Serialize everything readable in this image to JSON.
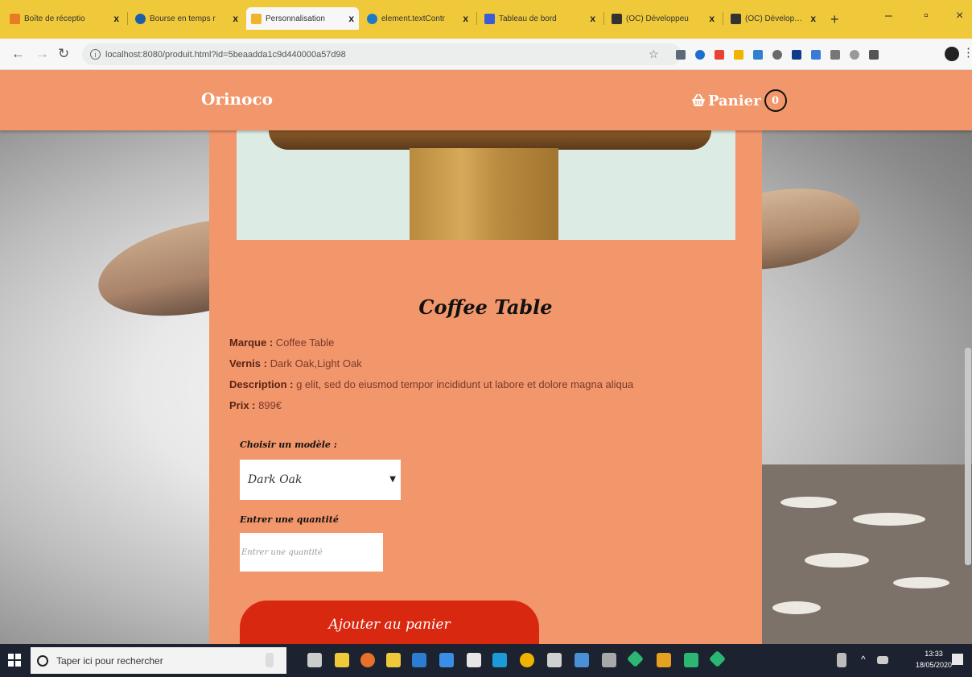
{
  "browser": {
    "tabs": [
      {
        "title": "Boîte de réceptio",
        "color": "#e87b24"
      },
      {
        "title": "Bourse en temps r",
        "color": "#1b5fa8"
      },
      {
        "title": "Personnalisation",
        "color": "#f0b429",
        "active": true
      },
      {
        "title": "element.textContr",
        "color": "#1e7ac4"
      },
      {
        "title": "Tableau de bord",
        "color": "#3c5cd6"
      },
      {
        "title": "(OC) Développeu",
        "color": "#333333"
      },
      {
        "title": "(OC) Développeu",
        "color": "#333333"
      }
    ],
    "close_glyph": "x",
    "url": "localhost:8080/produit.html?id=5beaadda1c9d440000a57d98"
  },
  "site": {
    "brand": "Orinoco",
    "cart_label": "Panier",
    "cart_count": "0",
    "accent": "#f2966b",
    "button_color": "#d92810"
  },
  "product": {
    "name": "Coffee Table",
    "brand_label": "Marque :",
    "brand_value": "Coffee Table",
    "varnish_label": "Vernis :",
    "varnish_value": "Dark Oak,Light Oak",
    "description_label": "Description :",
    "description_value": "g elit, sed do eiusmod tempor incididunt ut labore et dolore magna aliqua",
    "price_label": "Prix :",
    "price_value": "899€"
  },
  "form": {
    "model_label": "Choisir un modèle :",
    "model_selected": "Dark Oak",
    "quantity_label": "Entrer une quantité",
    "quantity_placeholder": "Entrer une quantité",
    "add_button": "Ajouter au panier"
  },
  "taskbar": {
    "search_placeholder": "Taper ici pour rechercher",
    "time": "13:33",
    "date": "18/05/2020"
  }
}
